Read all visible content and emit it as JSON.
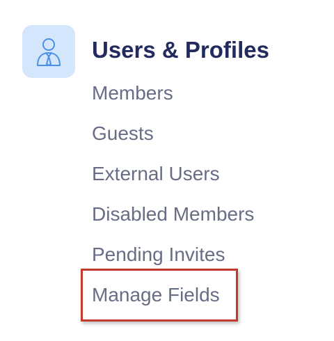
{
  "section": {
    "icon": "user-profile-icon",
    "title": "Users & Profiles",
    "items": [
      {
        "label": "Members"
      },
      {
        "label": "Guests"
      },
      {
        "label": "External Users"
      },
      {
        "label": "Disabled Members"
      },
      {
        "label": "Pending Invites"
      },
      {
        "label": "Manage Fields",
        "highlighted": true
      }
    ]
  },
  "colors": {
    "icon_background": "#d4e6fb",
    "icon_stroke": "#4a8fe6",
    "title": "#222a5e",
    "item_text": "#686d86",
    "highlight": "#c33a2c"
  }
}
